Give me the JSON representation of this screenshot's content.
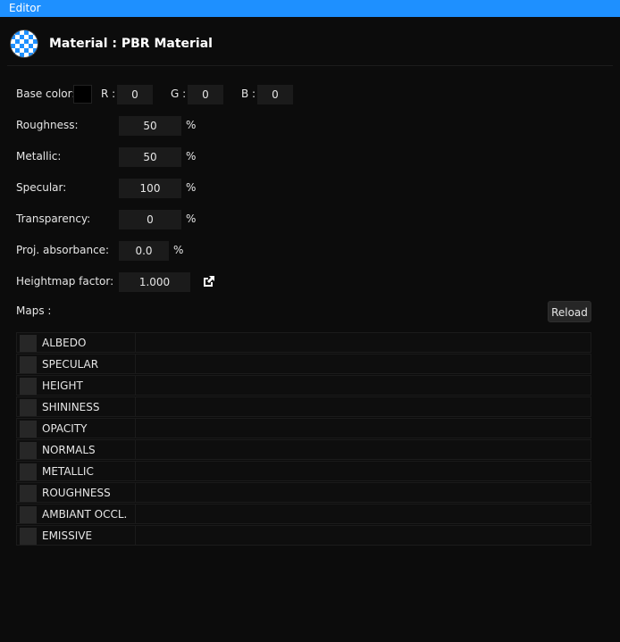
{
  "window": {
    "title": "Editor"
  },
  "header": {
    "title": "Material : PBR Material",
    "icon": "material-sphere-icon"
  },
  "base_color": {
    "label": "Base color:",
    "swatch_color": "#000000",
    "r_label": "R :",
    "r_value": "0",
    "g_label": "G :",
    "g_value": "0",
    "b_label": "B :",
    "b_value": "0"
  },
  "properties": {
    "roughness": {
      "label": "Roughness:",
      "value": "50",
      "unit": "%"
    },
    "metallic": {
      "label": "Metallic:",
      "value": "50",
      "unit": "%"
    },
    "specular": {
      "label": "Specular:",
      "value": "100",
      "unit": "%"
    },
    "transparency": {
      "label": "Transparency:",
      "value": "0",
      "unit": "%"
    },
    "proj_absorbance": {
      "label": "Proj. absorbance:",
      "value": "0.0",
      "unit": "%"
    },
    "heightmap_factor": {
      "label": "Heightmap factor:",
      "value": "1.000",
      "icon": "external-link-icon"
    }
  },
  "maps": {
    "label": "Maps :",
    "reload_label": "Reload",
    "items": [
      "ALBEDO",
      "SPECULAR",
      "HEIGHT",
      "SHININESS",
      "OPACITY",
      "NORMALS",
      "METALLIC",
      "ROUGHNESS",
      "AMBIANT OCCL.",
      "EMISSIVE"
    ]
  },
  "colors": {
    "accent": "#1e90ff",
    "background": "#0c0c0c",
    "field": "#1b1b1b"
  }
}
